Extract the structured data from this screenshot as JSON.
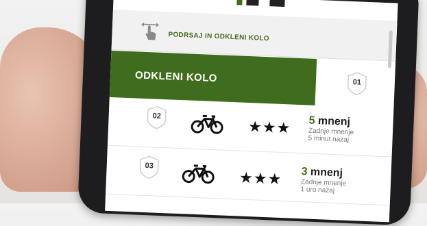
{
  "hint": {
    "text": "PODRSAJ IN ODKLENI KOLO",
    "icon": "swipe-hand-icon"
  },
  "unlock": {
    "label": "ODKLENI KOLO",
    "color": "#406d1d"
  },
  "stations": [
    {
      "number": "01"
    },
    {
      "number": "02",
      "stars": "★★★",
      "count": "5",
      "count_label": "mnenj",
      "last_line1": "Zadnje mnenje",
      "last_line2": "5 minut nazaj"
    },
    {
      "number": "03",
      "stars": "★★★",
      "count": "3",
      "count_label": "mnenj",
      "last_line1": "Zadnje mnenje",
      "last_line2": "1 uro nazaj"
    }
  ],
  "colors": {
    "accent": "#406d1d",
    "text_green": "#3f6c1b"
  }
}
